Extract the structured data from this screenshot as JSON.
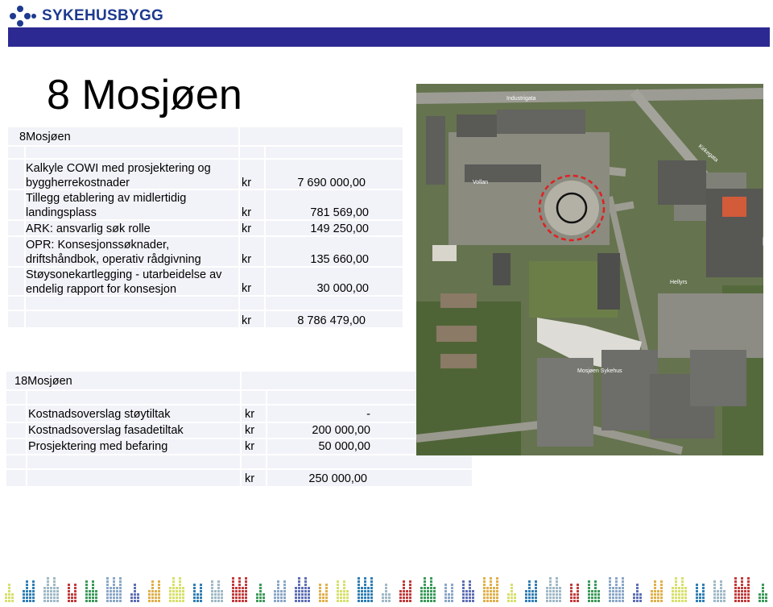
{
  "header": {
    "logo_text": "SYKEHUSBYGG",
    "brand_color": "#1d3a8f",
    "bar_color": "#2c2a92"
  },
  "page_title": "8 Mosjøen",
  "table1": {
    "heading": "8Mosjøen",
    "rows": [
      {
        "desc": "Kalkyle COWI med prosjektering og byggherrekostnader",
        "cur": "kr",
        "amount": "7 690 000,00"
      },
      {
        "desc": "Tillegg etablering av midlertidig landingsplass",
        "cur": "kr",
        "amount": "781 569,00"
      },
      {
        "desc": "ARK: ansvarlig søk rolle",
        "cur": "kr",
        "amount": "149 250,00"
      },
      {
        "desc": "OPR: Konsesjonssøknader, driftshåndbok, operativ rådgivning",
        "cur": "kr",
        "amount": "135 660,00"
      },
      {
        "desc": "Støysonekartlegging - utarbeidelse av endelig rapport for konsesjon",
        "cur": "kr",
        "amount": "30 000,00"
      }
    ],
    "total": {
      "cur": "kr",
      "amount": "8 786 479,00"
    }
  },
  "table2": {
    "heading": "18Mosjøen",
    "rows": [
      {
        "desc": "Kostnadsoverslag støytiltak",
        "cur": "kr",
        "amount": "-"
      },
      {
        "desc": "Kostnadsoverslag fasadetiltak",
        "cur": "kr",
        "amount": "200 000,00"
      },
      {
        "desc": "Prosjektering med befaring",
        "cur": "kr",
        "amount": "50 000,00"
      }
    ],
    "total": {
      "cur": "kr",
      "amount": "250 000,00"
    }
  },
  "map": {
    "labels": [
      "Industrigata",
      "Vollan",
      "Kirkegata",
      "Hellyrs",
      "Mosjøen Sykehus"
    ],
    "marker_color": "#e02020"
  }
}
